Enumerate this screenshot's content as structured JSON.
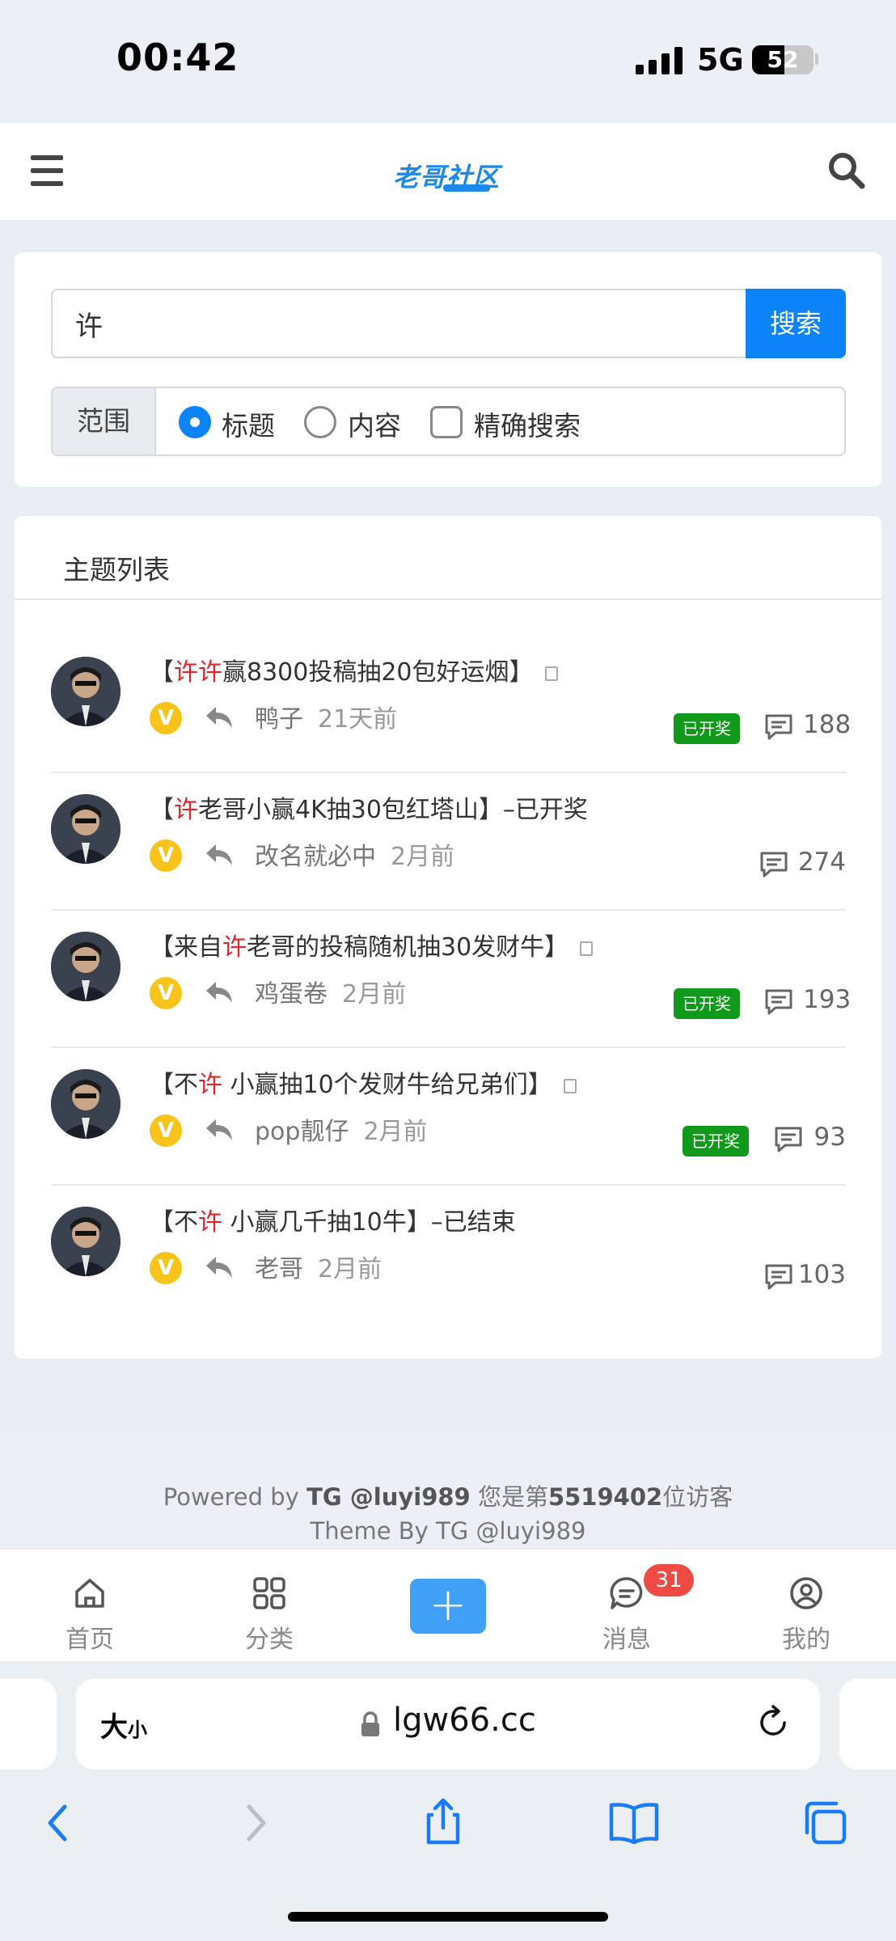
{
  "status_bar": {
    "time": "00:42",
    "network": "5G",
    "battery": "52"
  },
  "header": {
    "logo_text": "老哥社区",
    "menu_icon": "hamburger-menu-icon",
    "search_icon": "search-icon"
  },
  "search": {
    "query": "许",
    "button_label": "搜索",
    "scope_label": "范围",
    "options": [
      {
        "label": "标题",
        "checked": true
      },
      {
        "label": "内容",
        "checked": false
      },
      {
        "label": "精确搜索",
        "checked": false
      }
    ]
  },
  "topics": {
    "heading": "主题列表",
    "items": [
      {
        "title_pre": "【",
        "title_hl": "许许",
        "title_post": "赢8300投稿抽20包好运烟】",
        "author": "鸭子",
        "time": "21天前",
        "badge": "已开奖",
        "count": "188",
        "locked": true
      },
      {
        "title_pre": "【",
        "title_hl": "许",
        "title_post": "老哥小赢4K抽30包红塔山】–已开奖",
        "author": "改名就必中",
        "time": "2月前",
        "badge": "",
        "count": "274",
        "locked": false
      },
      {
        "title_pre": "【来自",
        "title_hl": "许",
        "title_post": "老哥的投稿随机抽30发财牛】",
        "author": "鸡蛋卷",
        "time": "2月前",
        "badge": "已开奖",
        "count": "193",
        "locked": true
      },
      {
        "title_pre": "【不",
        "title_hl": "许",
        "title_post": " 小赢抽10个发财牛给兄弟们】",
        "author": "pop靓仔",
        "time": "2月前",
        "badge": "已开奖",
        "count": "93",
        "locked": true
      },
      {
        "title_pre": "【不",
        "title_hl": "许",
        "title_post": " 小赢几千抽10牛】–已结束",
        "author": "老哥",
        "time": "2月前",
        "badge": "",
        "count": "103",
        "locked": false
      }
    ]
  },
  "footer": {
    "powered_prefix": "Powered by ",
    "powered_by": "TG @luyi989",
    "visitor_prefix": " 您是第",
    "visitor_count": "5519402",
    "visitor_suffix": "位访客",
    "theme": "Theme By TG @luyi989"
  },
  "tabbar": {
    "home": "首页",
    "category": "分类",
    "add": "+",
    "messages": "消息",
    "unread": "31",
    "mine": "我的"
  },
  "browser": {
    "text_size": "大",
    "text_size_small": "小",
    "url": "lgw66.cc"
  },
  "colors": {
    "accent": "#0d83f9",
    "highlight": "#e0242c",
    "badge": "#11991b",
    "vip": "#f8c31b"
  }
}
